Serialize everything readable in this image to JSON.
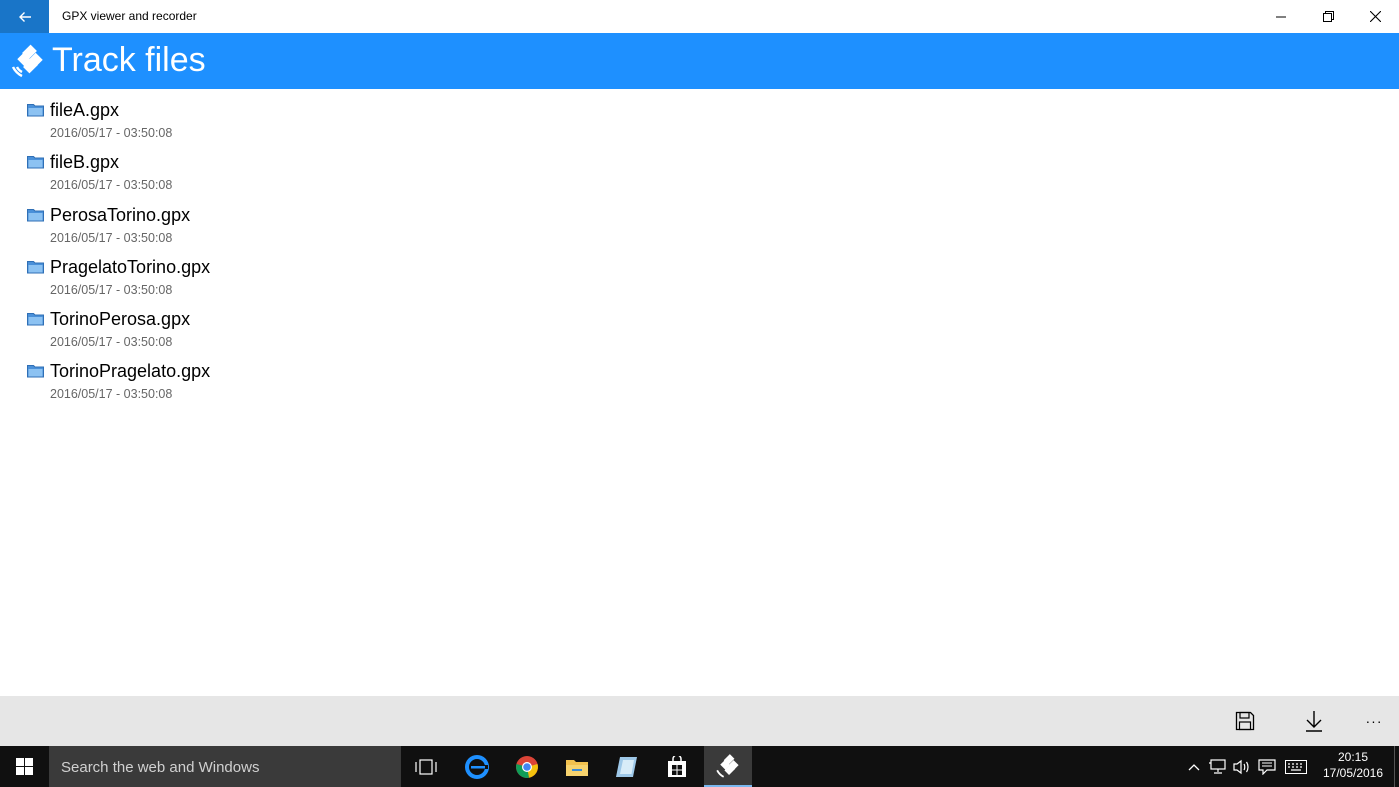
{
  "window": {
    "app_title": "GPX viewer and recorder",
    "buttons": [
      "back-arrow-icon",
      "minimize-icon",
      "restore-icon",
      "close-icon"
    ]
  },
  "header": {
    "title": "Track files",
    "icon": "satellite-icon"
  },
  "files": [
    {
      "name": "fileA.gpx",
      "date": "2016/05/17 - 03:50:08"
    },
    {
      "name": "fileB.gpx",
      "date": "2016/05/17 - 03:50:08"
    },
    {
      "name": "PerosaTorino.gpx",
      "date": "2016/05/17 - 03:50:08"
    },
    {
      "name": "PragelatoTorino.gpx",
      "date": "2016/05/17 - 03:50:08"
    },
    {
      "name": "TorinoPerosa.gpx",
      "date": "2016/05/17 - 03:50:08"
    },
    {
      "name": "TorinoPragelato.gpx",
      "date": "2016/05/17 - 03:50:08"
    }
  ],
  "command_bar": {
    "icons": [
      "save-icon",
      "download-icon",
      "more-icon"
    ],
    "more_label": "···"
  },
  "taskbar": {
    "search_placeholder": "Search the web and Windows",
    "apps": [
      "task-view-icon",
      "edge-icon",
      "chrome-icon",
      "file-explorer-icon",
      "app-icon",
      "store-icon",
      "gpx-app-icon"
    ],
    "tray": [
      "chevron-up-icon",
      "network-icon",
      "volume-icon",
      "notification-icon",
      "keyboard-icon"
    ],
    "time": "20:15",
    "date": "17/05/2016"
  },
  "colors": {
    "accent": "#1e90ff",
    "back_button": "#1975c8",
    "command_bar": "#e6e6e6",
    "taskbar": "#101010"
  }
}
